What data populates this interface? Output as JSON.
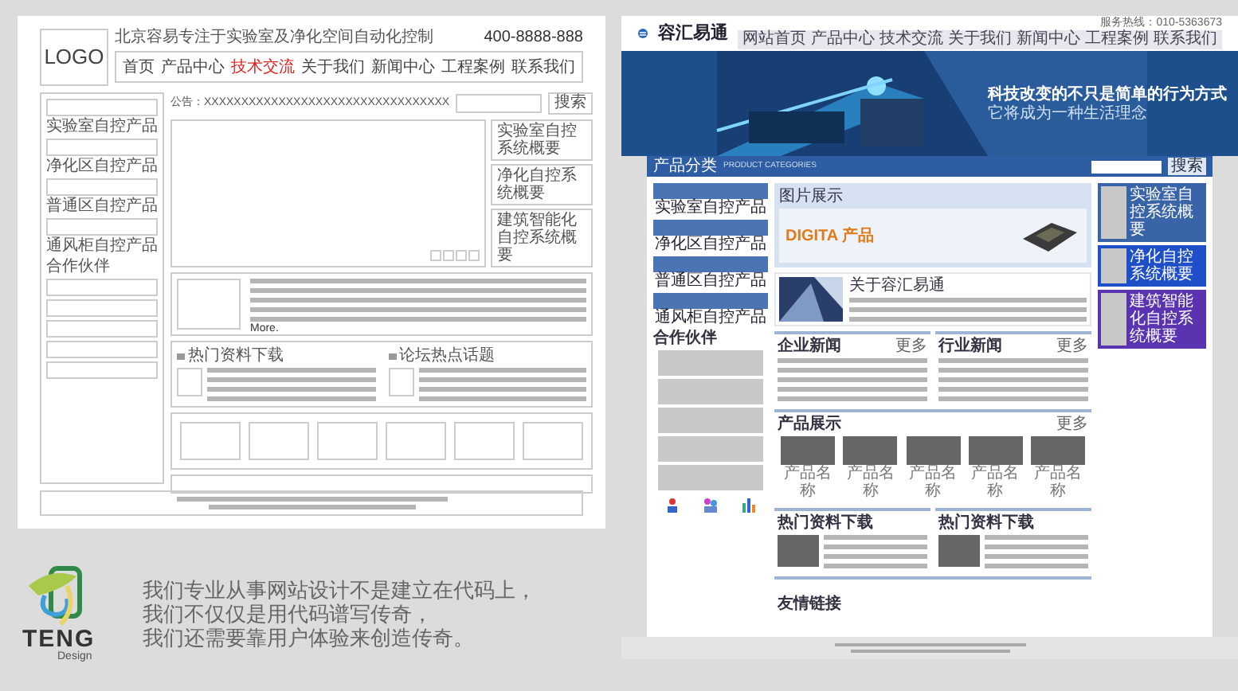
{
  "wireframe": {
    "logo": "LOGO",
    "tagline": "北京容易专注于实验室及净化空间自动化控制",
    "phone": "400-8888-888",
    "nav": [
      {
        "label": "首页",
        "selected": false
      },
      {
        "label": "产品中心",
        "selected": false
      },
      {
        "label": "技术交流",
        "selected": true
      },
      {
        "label": "关于我们",
        "selected": false
      },
      {
        "label": "新闻中心",
        "selected": false
      },
      {
        "label": "工程案例",
        "selected": false
      },
      {
        "label": "联系我们",
        "selected": false
      }
    ],
    "notice": "公告：XXXXXXXXXXXXXXXXXXXXXXXXXXXXXXXXX",
    "search_button": "搜索",
    "sidebar": [
      "实验室自控产品",
      "净化区自控产品",
      "普通区自控产品",
      "通风柜自控产品"
    ],
    "partners_title": "合作伙伴",
    "systems": [
      "实验室自控系统概要",
      "净化自控系统概要",
      "建筑智能化自控系统概要"
    ],
    "more": "More.",
    "sections": [
      "热门资料下载",
      "论坛热点话题"
    ]
  },
  "brand": {
    "name": "TENG",
    "sub": "Design",
    "slogan": [
      "我们专业从事网站设计不是建立在代码上，",
      "我们不仅仅是用代码谱写传奇，",
      "我们还需要靠用户体验来创造传奇。"
    ]
  },
  "mockup": {
    "logo": "容汇易通",
    "hotline": "服务热线：010-5363673",
    "nav": [
      {
        "label": "网站首页",
        "selected": false
      },
      {
        "label": "产品中心",
        "selected": false
      },
      {
        "label": "技术交流",
        "selected": false
      },
      {
        "label": "关于我们",
        "selected": false
      },
      {
        "label": "新闻中心",
        "selected": false
      },
      {
        "label": "工程案例",
        "selected": false
      },
      {
        "label": "联系我们",
        "selected": false
      }
    ],
    "banner": {
      "headline": "科技改变的不只是简单的行为方式",
      "subline": "它将成为一种生活理念"
    },
    "categories_title": "产品分类",
    "categories_en": "PRODUCT CATEGORIES",
    "search_button": "搜索",
    "categories": [
      "实验室自控产品",
      "净化区自控产品",
      "普通区自控产品",
      "通风柜自控产品"
    ],
    "partners_title": "合作伙伴",
    "pictures_title": "图片展示",
    "promo": "DIGITA 产品",
    "about_title": "关于容汇易通",
    "news": [
      {
        "title": "企业新闻",
        "more": "更多"
      },
      {
        "title": "行业新闻",
        "more": "更多"
      }
    ],
    "products_title": "产品展示",
    "products_more": "更多",
    "products": [
      "产品名称",
      "产品名称",
      "产品名称",
      "产品名称",
      "产品名称"
    ],
    "downloads": [
      "热门资料下载",
      "热门资料下载"
    ],
    "links_title": "友情链接",
    "systems": [
      {
        "label": "实验室自控系统概要",
        "color": "#3a64a8"
      },
      {
        "label": "净化自控系统概要",
        "color": "#1f4fc8"
      },
      {
        "label": "建筑智能化自控系统概要",
        "color": "#5a34b0"
      }
    ]
  }
}
